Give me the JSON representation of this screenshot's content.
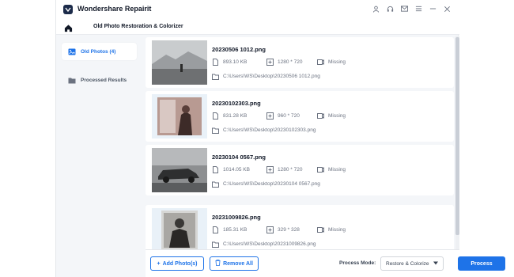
{
  "app": {
    "title": "Wondershare Repairit",
    "subtitle": "Old Photo Restoration & Colorizer",
    "accent_color": "#1e73e8"
  },
  "titlebar_icons": [
    "user-icon",
    "headset-icon",
    "mail-icon",
    "menu-icon",
    "minimize-icon",
    "close-icon"
  ],
  "sidebar": {
    "items": [
      {
        "label": "Old Photos (4)",
        "icon": "image-icon",
        "active": true
      },
      {
        "label": "Processed Results",
        "icon": "folder-icon",
        "active": false
      }
    ]
  },
  "photos": [
    {
      "name": "20230506 1012.png",
      "size": "893.10 KB",
      "resolution": "1280 * 720",
      "status": "Missing",
      "path": "C:\\Users\\WS\\Desktop\\20230506 1012.png"
    },
    {
      "name": "20230102303.png",
      "size": "831.28 KB",
      "resolution": "960 * 720",
      "status": "Missing",
      "path": "C:\\Users\\WS\\Desktop\\20230102303.png"
    },
    {
      "name": "20230104 0567.png",
      "size": "1014.05 KB",
      "resolution": "1280 * 720",
      "status": "Missing",
      "path": "C:\\Users\\WS\\Desktop\\20230104 0567.png"
    },
    {
      "name": "20231009826.png",
      "size": "185.31 KB",
      "resolution": "329 * 328",
      "status": "Missing",
      "path": "C:\\Users\\WS\\Desktop\\20231009826.png"
    }
  ],
  "footer": {
    "add_label": "Add Photo(s)",
    "remove_label": "Remove All",
    "process_mode_label": "Process Mode:",
    "process_mode_value": "Restore & Colorize",
    "process_label": "Process"
  }
}
